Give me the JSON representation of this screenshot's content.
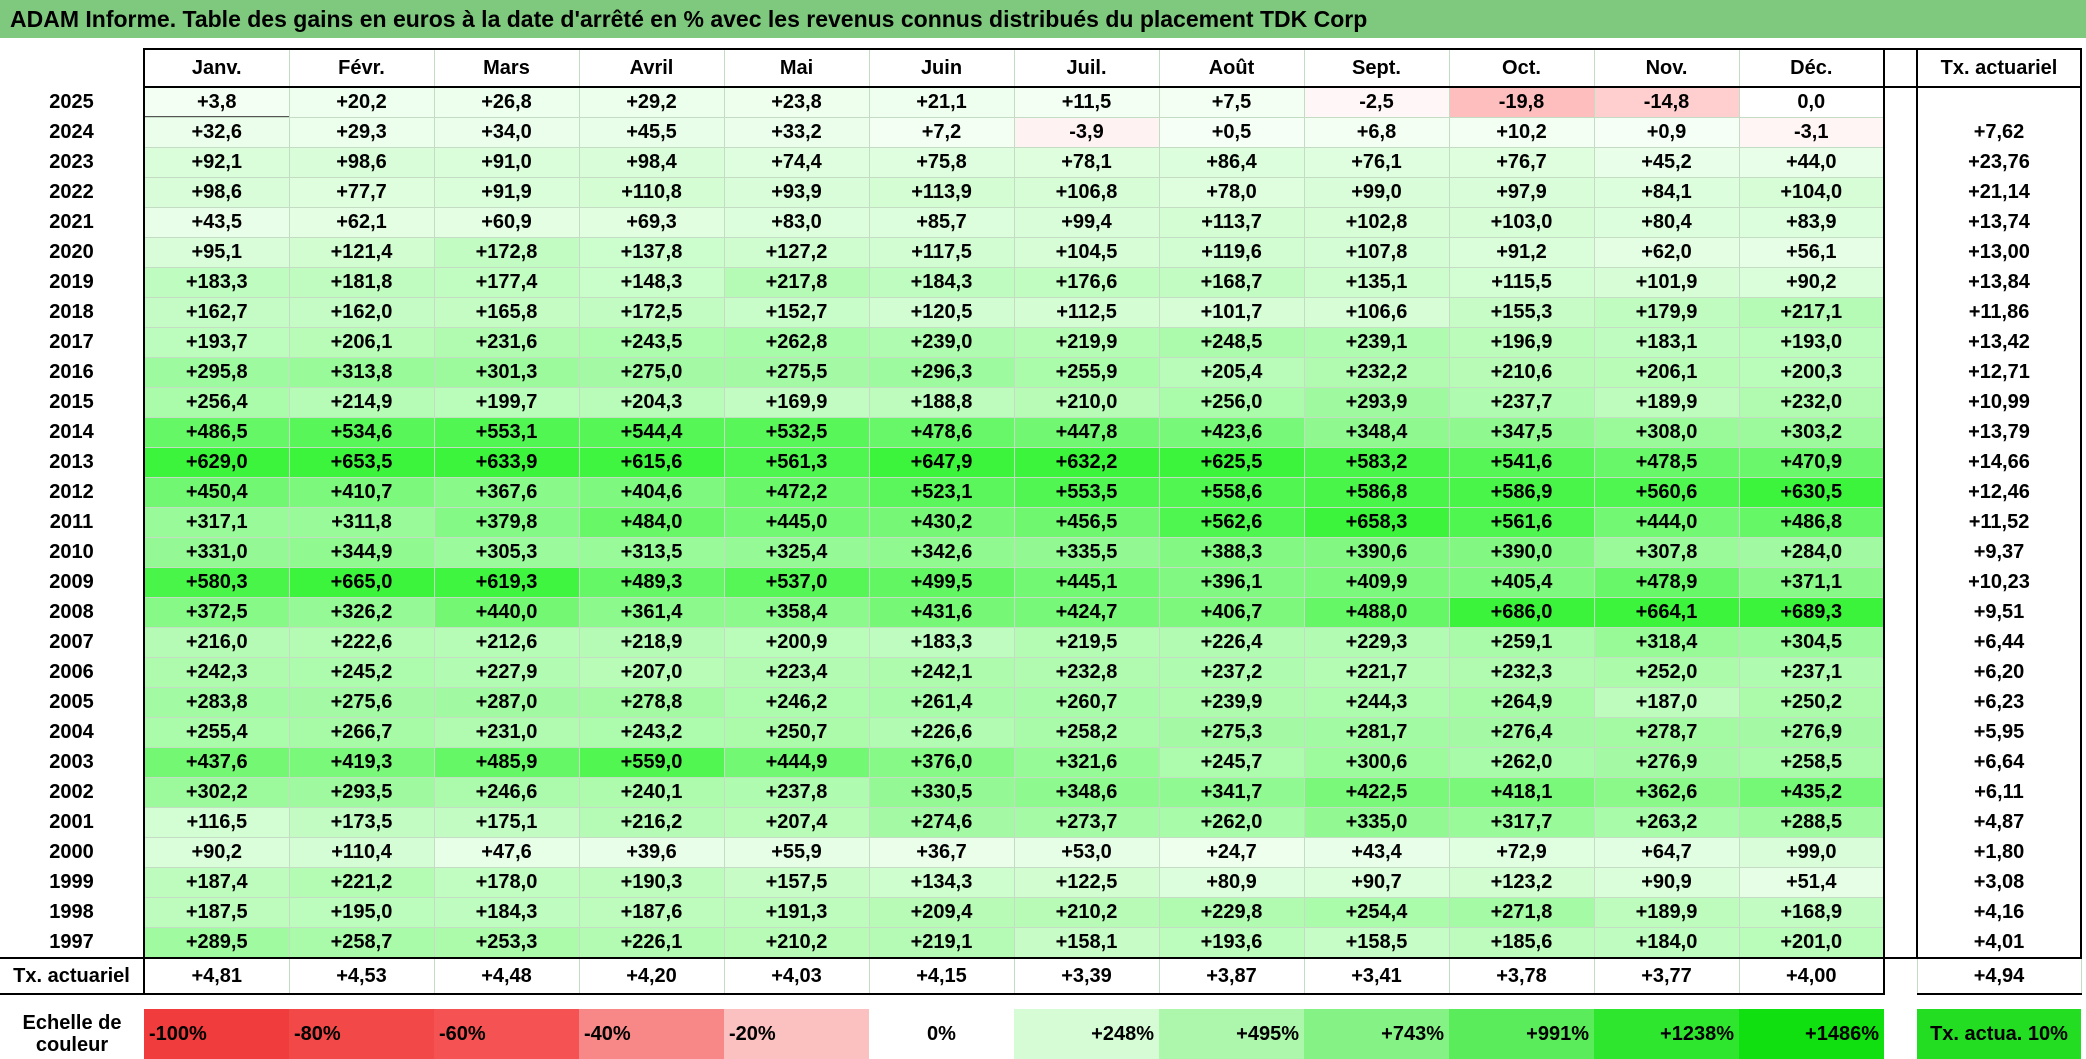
{
  "title": "ADAM Informe. Table des gains en euros à la date d'arrêté en % avec les revenus connus distribués du placement TDK Corp",
  "months": [
    "Janv.",
    "Févr.",
    "Mars",
    "Avril",
    "Mai",
    "Juin",
    "Juil.",
    "Août",
    "Sept.",
    "Oct.",
    "Nov.",
    "Déc."
  ],
  "annual_header": "Tx. actuariel",
  "rows": [
    {
      "year": "2025",
      "values": [
        "+3,8",
        "+20,2",
        "+26,8",
        "+29,2",
        "+23,8",
        "+21,1",
        "+11,5",
        "+7,5",
        "-2,5",
        "-19,8",
        "-14,8",
        "0,0"
      ],
      "rate": ""
    },
    {
      "year": "2024",
      "values": [
        "+32,6",
        "+29,3",
        "+34,0",
        "+45,5",
        "+33,2",
        "+7,2",
        "-3,9",
        "+0,5",
        "+6,8",
        "+10,2",
        "+0,9",
        "-3,1"
      ],
      "rate": "+7,62"
    },
    {
      "year": "2023",
      "values": [
        "+92,1",
        "+98,6",
        "+91,0",
        "+98,4",
        "+74,4",
        "+75,8",
        "+78,1",
        "+86,4",
        "+76,1",
        "+76,7",
        "+45,2",
        "+44,0"
      ],
      "rate": "+23,76"
    },
    {
      "year": "2022",
      "values": [
        "+98,6",
        "+77,7",
        "+91,9",
        "+110,8",
        "+93,9",
        "+113,9",
        "+106,8",
        "+78,0",
        "+99,0",
        "+97,9",
        "+84,1",
        "+104,0"
      ],
      "rate": "+21,14"
    },
    {
      "year": "2021",
      "values": [
        "+43,5",
        "+62,1",
        "+60,9",
        "+69,3",
        "+83,0",
        "+85,7",
        "+99,4",
        "+113,7",
        "+102,8",
        "+103,0",
        "+80,4",
        "+83,9"
      ],
      "rate": "+13,74"
    },
    {
      "year": "2020",
      "values": [
        "+95,1",
        "+121,4",
        "+172,8",
        "+137,8",
        "+127,2",
        "+117,5",
        "+104,5",
        "+119,6",
        "+107,8",
        "+91,2",
        "+62,0",
        "+56,1"
      ],
      "rate": "+13,00"
    },
    {
      "year": "2019",
      "values": [
        "+183,3",
        "+181,8",
        "+177,4",
        "+148,3",
        "+217,8",
        "+184,3",
        "+176,6",
        "+168,7",
        "+135,1",
        "+115,5",
        "+101,9",
        "+90,2"
      ],
      "rate": "+13,84"
    },
    {
      "year": "2018",
      "values": [
        "+162,7",
        "+162,0",
        "+165,8",
        "+172,5",
        "+152,7",
        "+120,5",
        "+112,5",
        "+101,7",
        "+106,6",
        "+155,3",
        "+179,9",
        "+217,1"
      ],
      "rate": "+11,86"
    },
    {
      "year": "2017",
      "values": [
        "+193,7",
        "+206,1",
        "+231,6",
        "+243,5",
        "+262,8",
        "+239,0",
        "+219,9",
        "+248,5",
        "+239,1",
        "+196,9",
        "+183,1",
        "+193,0"
      ],
      "rate": "+13,42"
    },
    {
      "year": "2016",
      "values": [
        "+295,8",
        "+313,8",
        "+301,3",
        "+275,0",
        "+275,5",
        "+296,3",
        "+255,9",
        "+205,4",
        "+232,2",
        "+210,6",
        "+206,1",
        "+200,3"
      ],
      "rate": "+12,71"
    },
    {
      "year": "2015",
      "values": [
        "+256,4",
        "+214,9",
        "+199,7",
        "+204,3",
        "+169,9",
        "+188,8",
        "+210,0",
        "+256,0",
        "+293,9",
        "+237,7",
        "+189,9",
        "+232,0"
      ],
      "rate": "+10,99"
    },
    {
      "year": "2014",
      "values": [
        "+486,5",
        "+534,6",
        "+553,1",
        "+544,4",
        "+532,5",
        "+478,6",
        "+447,8",
        "+423,6",
        "+348,4",
        "+347,5",
        "+308,0",
        "+303,2"
      ],
      "rate": "+13,79"
    },
    {
      "year": "2013",
      "values": [
        "+629,0",
        "+653,5",
        "+633,9",
        "+615,6",
        "+561,3",
        "+647,9",
        "+632,2",
        "+625,5",
        "+583,2",
        "+541,6",
        "+478,5",
        "+470,9"
      ],
      "rate": "+14,66"
    },
    {
      "year": "2012",
      "values": [
        "+450,4",
        "+410,7",
        "+367,6",
        "+404,6",
        "+472,2",
        "+523,1",
        "+553,5",
        "+558,6",
        "+586,8",
        "+586,9",
        "+560,6",
        "+630,5"
      ],
      "rate": "+12,46"
    },
    {
      "year": "2011",
      "values": [
        "+317,1",
        "+311,8",
        "+379,8",
        "+484,0",
        "+445,0",
        "+430,2",
        "+456,5",
        "+562,6",
        "+658,3",
        "+561,6",
        "+444,0",
        "+486,8"
      ],
      "rate": "+11,52"
    },
    {
      "year": "2010",
      "values": [
        "+331,0",
        "+344,9",
        "+305,3",
        "+313,5",
        "+325,4",
        "+342,6",
        "+335,5",
        "+388,3",
        "+390,6",
        "+390,0",
        "+307,8",
        "+284,0"
      ],
      "rate": "+9,37"
    },
    {
      "year": "2009",
      "values": [
        "+580,3",
        "+665,0",
        "+619,3",
        "+489,3",
        "+537,0",
        "+499,5",
        "+445,1",
        "+396,1",
        "+409,9",
        "+405,4",
        "+478,9",
        "+371,1"
      ],
      "rate": "+10,23"
    },
    {
      "year": "2008",
      "values": [
        "+372,5",
        "+326,2",
        "+440,0",
        "+361,4",
        "+358,4",
        "+431,6",
        "+424,7",
        "+406,7",
        "+488,0",
        "+686,0",
        "+664,1",
        "+689,3"
      ],
      "rate": "+9,51"
    },
    {
      "year": "2007",
      "values": [
        "+216,0",
        "+222,6",
        "+212,6",
        "+218,9",
        "+200,9",
        "+183,3",
        "+219,5",
        "+226,4",
        "+229,3",
        "+259,1",
        "+318,4",
        "+304,5"
      ],
      "rate": "+6,44"
    },
    {
      "year": "2006",
      "values": [
        "+242,3",
        "+245,2",
        "+227,9",
        "+207,0",
        "+223,4",
        "+242,1",
        "+232,8",
        "+237,2",
        "+221,7",
        "+232,3",
        "+252,0",
        "+237,1"
      ],
      "rate": "+6,20"
    },
    {
      "year": "2005",
      "values": [
        "+283,8",
        "+275,6",
        "+287,0",
        "+278,8",
        "+246,2",
        "+261,4",
        "+260,7",
        "+239,9",
        "+244,3",
        "+264,9",
        "+187,0",
        "+250,2"
      ],
      "rate": "+6,23"
    },
    {
      "year": "2004",
      "values": [
        "+255,4",
        "+266,7",
        "+231,0",
        "+243,2",
        "+250,7",
        "+226,6",
        "+258,2",
        "+275,3",
        "+281,7",
        "+276,4",
        "+278,7",
        "+276,9"
      ],
      "rate": "+5,95"
    },
    {
      "year": "2003",
      "values": [
        "+437,6",
        "+419,3",
        "+485,9",
        "+559,0",
        "+444,9",
        "+376,0",
        "+321,6",
        "+245,7",
        "+300,6",
        "+262,0",
        "+276,9",
        "+258,5"
      ],
      "rate": "+6,64"
    },
    {
      "year": "2002",
      "values": [
        "+302,2",
        "+293,5",
        "+246,6",
        "+240,1",
        "+237,8",
        "+330,5",
        "+348,6",
        "+341,7",
        "+422,5",
        "+418,1",
        "+362,6",
        "+435,2"
      ],
      "rate": "+6,11"
    },
    {
      "year": "2001",
      "values": [
        "+116,5",
        "+173,5",
        "+175,1",
        "+216,2",
        "+207,4",
        "+274,6",
        "+273,7",
        "+262,0",
        "+335,0",
        "+317,7",
        "+263,2",
        "+288,5"
      ],
      "rate": "+4,87"
    },
    {
      "year": "2000",
      "values": [
        "+90,2",
        "+110,4",
        "+47,6",
        "+39,6",
        "+55,9",
        "+36,7",
        "+53,0",
        "+24,7",
        "+43,4",
        "+72,9",
        "+64,7",
        "+99,0"
      ],
      "rate": "+1,80"
    },
    {
      "year": "1999",
      "values": [
        "+187,4",
        "+221,2",
        "+178,0",
        "+190,3",
        "+157,5",
        "+134,3",
        "+122,5",
        "+80,9",
        "+90,7",
        "+123,2",
        "+90,9",
        "+51,4"
      ],
      "rate": "+3,08"
    },
    {
      "year": "1998",
      "values": [
        "+187,5",
        "+195,0",
        "+184,3",
        "+187,6",
        "+191,3",
        "+209,4",
        "+210,2",
        "+229,8",
        "+254,4",
        "+271,8",
        "+189,9",
        "+168,9"
      ],
      "rate": "+4,16"
    },
    {
      "year": "1997",
      "values": [
        "+289,5",
        "+258,7",
        "+253,3",
        "+226,1",
        "+210,2",
        "+219,1",
        "+158,1",
        "+193,6",
        "+158,5",
        "+185,6",
        "+184,0",
        "+201,0"
      ],
      "rate": "+4,01"
    }
  ],
  "footer": {
    "label": "Tx. actuariel",
    "values": [
      "+4,81",
      "+4,53",
      "+4,48",
      "+4,20",
      "+4,03",
      "+4,15",
      "+3,39",
      "+3,87",
      "+3,41",
      "+3,78",
      "+3,77",
      "+4,00"
    ],
    "total": "+4,94"
  },
  "scale": {
    "label": "Echelle de couleur",
    "steps": [
      {
        "label": "-100%",
        "color": "#f03c3c",
        "kind": "neg"
      },
      {
        "label": "-80%",
        "color": "#f24848",
        "kind": "neg"
      },
      {
        "label": "-60%",
        "color": "#f55353",
        "kind": "neg"
      },
      {
        "label": "-40%",
        "color": "#f88888",
        "kind": "neg"
      },
      {
        "label": "-20%",
        "color": "#fbc0c0",
        "kind": "neg"
      },
      {
        "label": "0%",
        "color": "#ffffff",
        "kind": "zero"
      },
      {
        "label": "+248%",
        "color": "#d6fcd6",
        "kind": "pos"
      },
      {
        "label": "+495%",
        "color": "#adf7ad",
        "kind": "pos"
      },
      {
        "label": "+743%",
        "color": "#84f284",
        "kind": "pos"
      },
      {
        "label": "+991%",
        "color": "#5aec5a",
        "kind": "pos"
      },
      {
        "label": "+1238%",
        "color": "#2ee62e",
        "kind": "pos"
      },
      {
        "label": "+1486%",
        "color": "#10e010",
        "kind": "pos"
      }
    ],
    "rate_label": "Tx. actua. 10%"
  }
}
